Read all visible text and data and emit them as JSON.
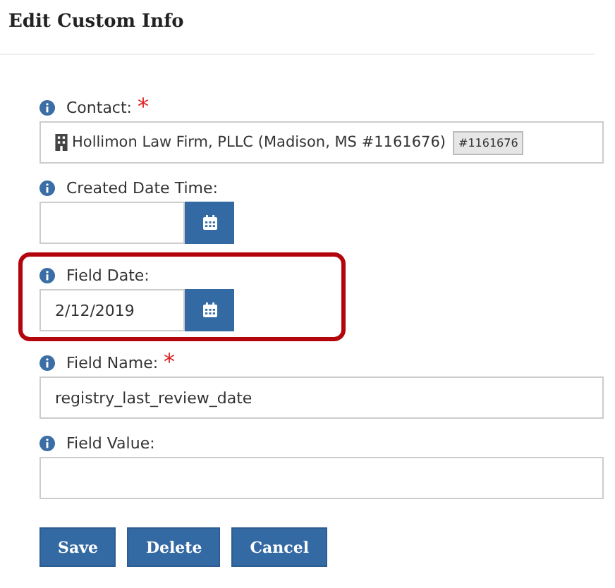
{
  "title": "Edit Custom Info",
  "fields": [
    {
      "kind": "contact",
      "label": "Contact:",
      "required_mark": "*",
      "highlighted": false,
      "value": "Hollimon Law Firm, PLLC (Madison, MS #1161676)",
      "badge": "#1161676"
    },
    {
      "kind": "date",
      "label": "Created Date Time:",
      "highlighted": false
    },
    {
      "kind": "date",
      "label": "Field Date:",
      "highlighted": true,
      "value": "2/12/2019"
    },
    {
      "kind": "text",
      "label": "Field Name:",
      "required_mark": "*",
      "highlighted": false,
      "value": "registry_last_review_date"
    },
    {
      "kind": "text",
      "label": "Field Value:",
      "highlighted": false
    }
  ],
  "buttons": [
    "Save",
    "Delete",
    "Cancel"
  ]
}
